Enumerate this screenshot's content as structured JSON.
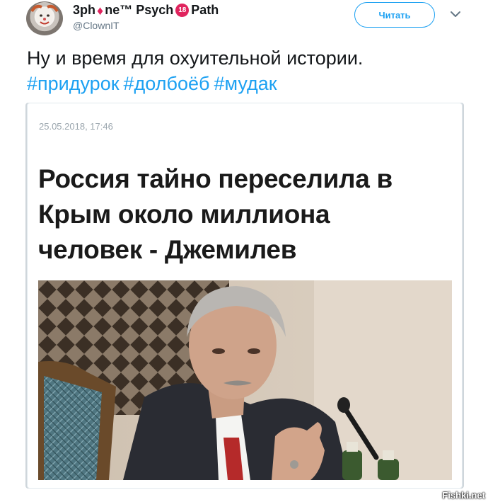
{
  "tweet": {
    "user_name_part1": "3ph",
    "user_name_part2": "ne™ Psych",
    "user_name_badge": "18",
    "user_name_part3": "Path",
    "handle": "@ClownIT",
    "follow_label": "Читать",
    "text": "Ну и время для охуительной истории.",
    "hashtags": [
      "#придурок",
      "#долбоёб",
      "#мудак"
    ]
  },
  "card": {
    "date": "25.05.2018, 17:46",
    "headline": "Россия тайно переселила в Крым около миллиона человек - Джемилев"
  },
  "watermark": "Fishki.net",
  "colors": {
    "link": "#1da1f2",
    "accent_badge": "#e0245e",
    "secondary_text": "#657786"
  },
  "icons": {
    "diamond": "diamond-icon",
    "age_badge": "eighteen-plus-icon",
    "more": "chevron-down-icon"
  }
}
